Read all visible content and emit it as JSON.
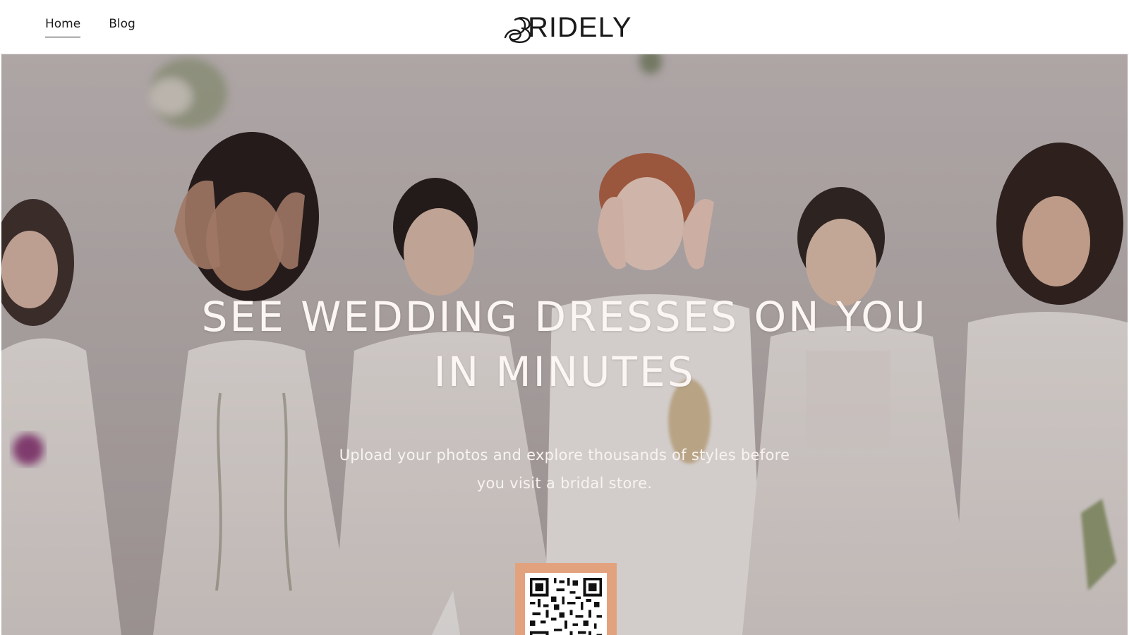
{
  "header": {
    "nav": [
      {
        "label": "Home",
        "active": true
      },
      {
        "label": "Blog",
        "active": false
      }
    ],
    "logo_text": "RIDELY",
    "logo_initial": "B"
  },
  "hero": {
    "title_line1": "SEE WEDDING DRESSES ON YOU",
    "title_line2": "IN MINUTES",
    "subtitle_line1": "Upload your photos and explore thousands of styles before",
    "subtitle_line2": "you visit a bridal store.",
    "qr_icon": "qr-code-icon",
    "colors": {
      "title": "#fbf6f3",
      "qr_card": "#e3a27e",
      "overlay": "#3c3032"
    }
  }
}
